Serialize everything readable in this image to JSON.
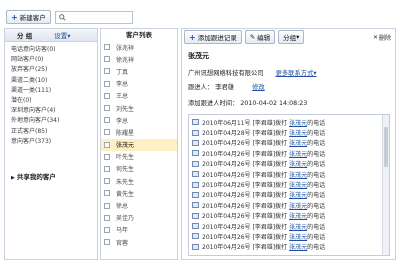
{
  "toolbar": {
    "new_customer": "新建客户",
    "search_placeholder": ""
  },
  "groups": {
    "header_title": "分 组",
    "settings_label": "设置",
    "items": [
      "电话意向访客(0)",
      "网站客户(0)",
      "放弃客户(25)",
      "渠道二类(10)",
      "渠道一类(111)",
      "潜在(0)",
      "深圳意向客户(4)",
      "外地意向客户(34)",
      "正式客户(85)",
      "意向客户(373)"
    ],
    "shared_label": "共享我的客户"
  },
  "customers": {
    "header_title": "客户列表",
    "rows": [
      "张兆祥",
      "徐兆祥",
      "丁真",
      "李总",
      "王总",
      "刘先生",
      "李总",
      "陈耀星",
      "张茂元",
      "叶先生",
      "何先生",
      "朱先生",
      "黄先生",
      "徐总",
      "吴佳乃",
      "马年",
      "官蓉"
    ],
    "selected_index": 8
  },
  "detail": {
    "add_record_label": "添加跟进记录",
    "edit_label": "编辑",
    "group_label": "分组",
    "close_label": "删除",
    "name": "张茂元",
    "company": "广州讯想网络科技有限公司",
    "more_contact_label": "更多联系方式",
    "follower_label": "跟进人：",
    "follower": "李君雄",
    "modify_label": "修改",
    "added_time_label": "添加跟进人时间：",
    "added_time": "2010-04-02 14:08:23",
    "logs": [
      {
        "text": "2010年06月11号 [李君雄]拨打",
        "who": "张茂元",
        "tail": "的电话"
      },
      {
        "text": "2010年04月28号 [李君雄]拨打",
        "who": "张茂元",
        "tail": "的电话"
      },
      {
        "text": "2010年04月26号 [李君雄]拨打",
        "who": "张茂元",
        "tail": "的电话"
      },
      {
        "text": "2010年04月26号 [李君雄]拨打",
        "who": "张茂元",
        "tail": "的电话"
      },
      {
        "text": "2010年04月26号 [李君雄]拨打",
        "who": "张茂元",
        "tail": "的电话"
      },
      {
        "text": "2010年04月26号 [李君雄]拨打",
        "who": "张茂元",
        "tail": "的电话"
      },
      {
        "text": "2010年04月26号 [李君雄]拨打",
        "who": "张茂元",
        "tail": "的电话"
      },
      {
        "text": "2010年04月26号 [李君雄]拨打",
        "who": "张茂元",
        "tail": "的电话"
      },
      {
        "text": "2010年04月26号 [李君雄]拨打",
        "who": "张茂元",
        "tail": "的电话"
      },
      {
        "text": "2010年04月26号 [李君雄]拨打",
        "who": "张茂元",
        "tail": "的电话"
      },
      {
        "text": "2010年04月26号 [李君雄]拨打",
        "who": "张茂元",
        "tail": "的电话"
      },
      {
        "text": "2010年04月26号 [李君雄]拨打",
        "who": "张茂元",
        "tail": "的电话"
      },
      {
        "text": "2010年04月26号 [李君雄]拨打",
        "who": "张茂元",
        "tail": "的电话"
      }
    ]
  },
  "colors": {
    "accent": "#1f4fa0",
    "border": "#c9d2de",
    "selected_row": "#fff0c4"
  }
}
